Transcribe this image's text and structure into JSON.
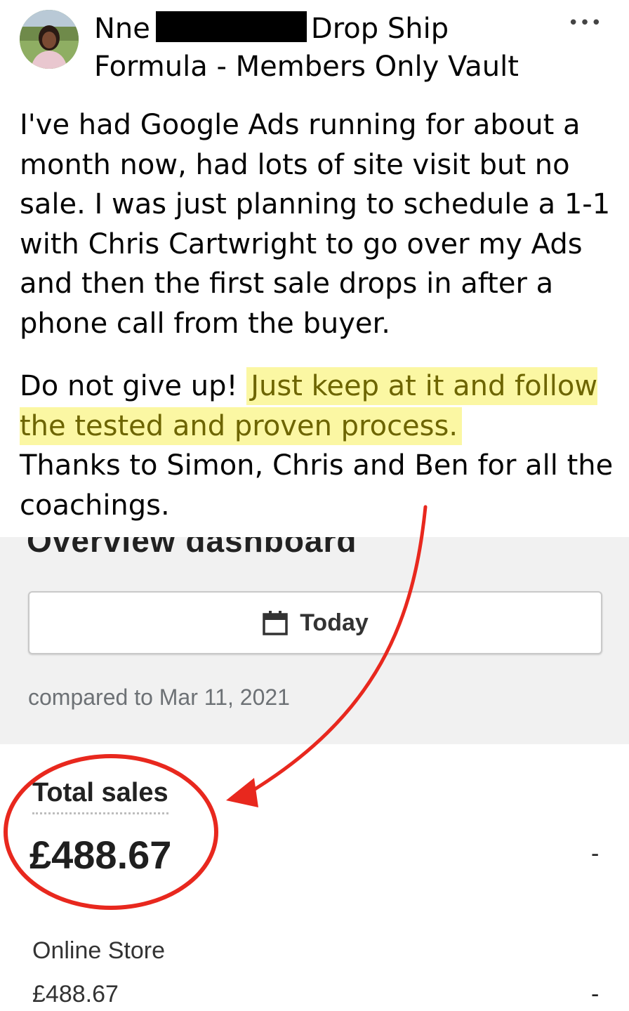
{
  "post": {
    "author_first": "Nne",
    "author_rest": "Drop Ship",
    "group_line2": "Formula - Members Only Vault",
    "more_icon": "•••",
    "paragraph1": "I've had Google Ads running for about a month now, had lots of site visit but no sale. I was just planning to schedule a 1-1 with Chris Cartwright to go over my Ads and then the first sale drops in after a phone call from the buyer.",
    "p2_plain": "Do not give up!",
    "p2_highlight": "Just keep at it and follow the tested and proven process.",
    "p3": "Thanks to Simon, Chris and Ben for all the coachings."
  },
  "dashboard": {
    "title": "Overview dashboard",
    "date_button": "Today",
    "compared": "compared to Mar 11, 2021",
    "total_sales_label": "Total sales",
    "total_sales_value": "£488.67",
    "total_sales_change": "-",
    "online_store_label": "Online Store",
    "online_store_value": "£488.67",
    "online_store_change": "-"
  },
  "colors": {
    "highlight_bg": "#fbf7a3",
    "highlight_text": "#6d6500",
    "annotation_red": "#e8281e",
    "dashboard_bg": "#f1f1f1"
  },
  "icons": [
    "more-options-icon",
    "calendar-icon",
    "arrow-annotation",
    "circle-annotation"
  ]
}
